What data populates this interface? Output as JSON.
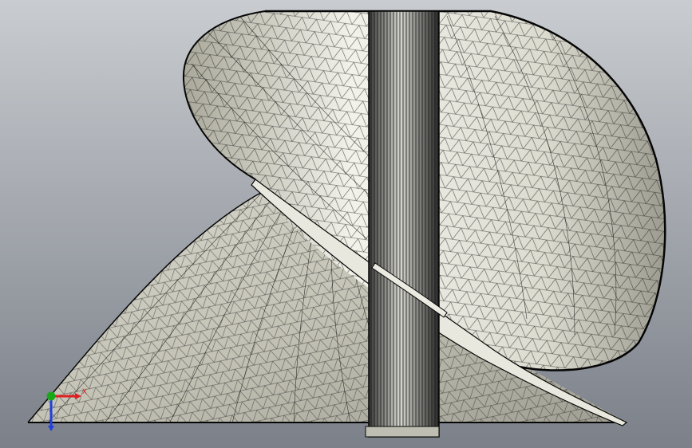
{
  "viewport": {
    "bg_top": "#c9ccd0",
    "bg_bottom": "#7b8089"
  },
  "model": {
    "surface_light": "#f7f7f2",
    "surface_mid": "#c9c8bb",
    "surface_dark": "#8b8a7f",
    "mesh_color": "#1a1a1a",
    "edge_color": "#050505"
  },
  "triad": {
    "x_color": "#e02020",
    "y_color": "#1aa81a",
    "z_color": "#2040e0",
    "x_label": "X"
  }
}
